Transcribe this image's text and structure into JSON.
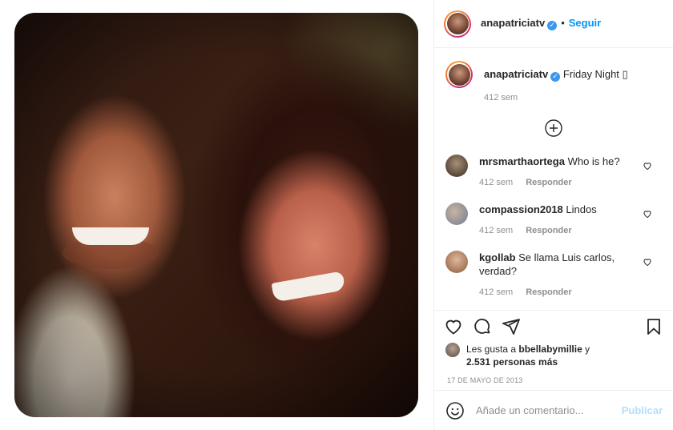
{
  "post": {
    "username": "anapatriciatv",
    "follow_label": "Seguir",
    "separator": "•",
    "caption": "Friday Night ▯",
    "caption_time": "412 sem"
  },
  "comments": [
    {
      "username": "mrsmarthaortega",
      "text": "Who is he?",
      "time": "412 sem",
      "reply": "Responder"
    },
    {
      "username": "compassion2018",
      "text": "Lindos",
      "time": "412 sem",
      "reply": "Responder"
    },
    {
      "username": "kgollab",
      "text": "Se llama Luis carlos, verdad?",
      "time": "412 sem",
      "reply": "Responder"
    }
  ],
  "likes": {
    "prefix": "Les gusta a",
    "user": "bbellabymillie",
    "joiner": "y",
    "others": "2.531 personas más"
  },
  "date": "17 DE MAYO DE 2013",
  "add_comment": {
    "placeholder": "Añade un comentario...",
    "publish_label": "Publicar"
  },
  "icons": {
    "verified": "verified-badge-icon",
    "add": "plus-circle-icon",
    "like": "heart-icon",
    "comment": "comment-bubble-icon",
    "share": "paper-plane-icon",
    "save": "bookmark-icon",
    "emoji": "smiley-icon"
  },
  "colors": {
    "link": "#0095f6",
    "verified": "#3897f0",
    "muted": "#8e8e8e",
    "publish_disabled": "#b2dffc"
  }
}
